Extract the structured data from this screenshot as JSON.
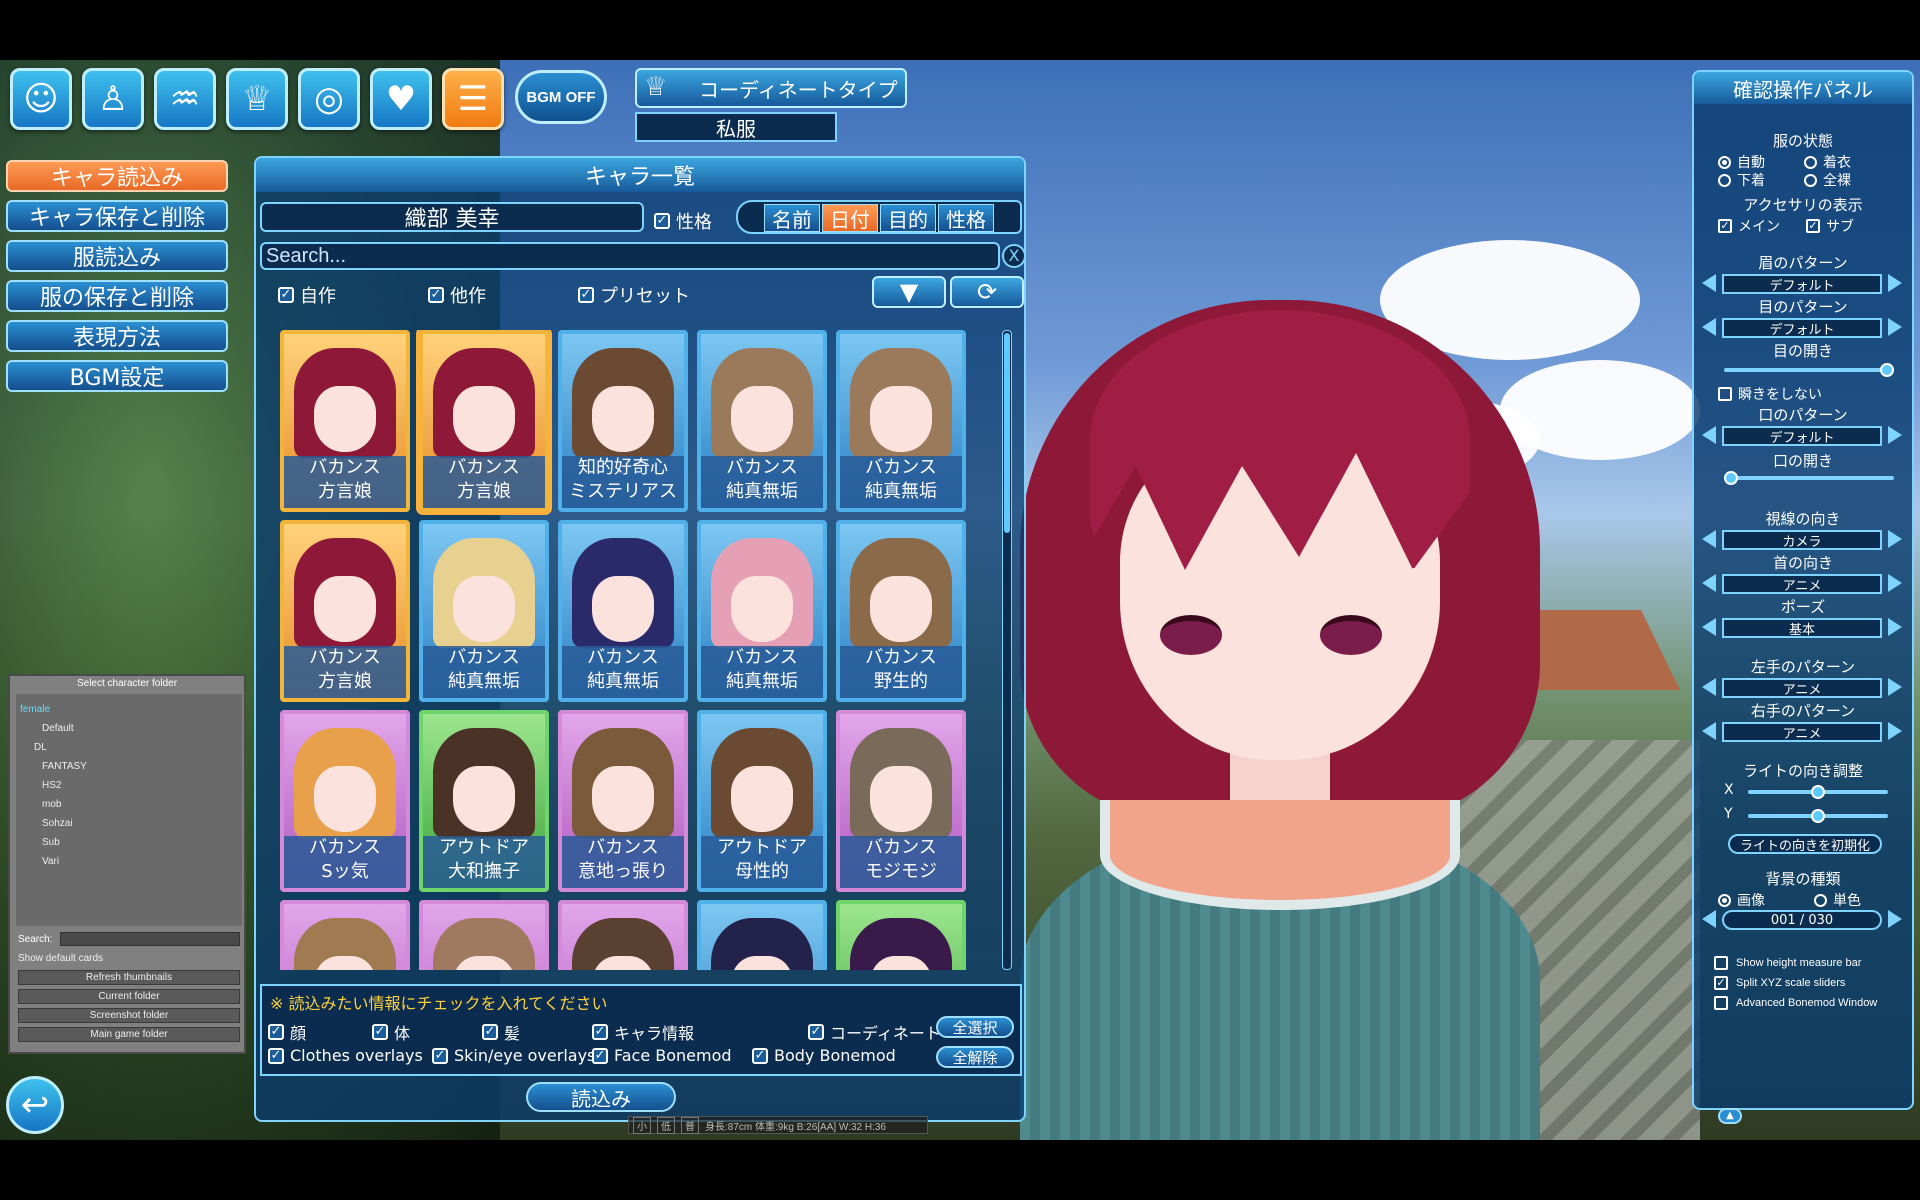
{
  "top_bar": {
    "icons": [
      {
        "name": "face-icon",
        "glyph": "☺"
      },
      {
        "name": "body-icon",
        "glyph": "♙"
      },
      {
        "name": "hair-icon",
        "glyph": "♒"
      },
      {
        "name": "clothes-icon",
        "glyph": "♕"
      },
      {
        "name": "accessory-ring-icon",
        "glyph": "◎"
      },
      {
        "name": "heart-icon",
        "glyph": "♥"
      },
      {
        "name": "menu-list-icon",
        "glyph": "☰"
      }
    ],
    "bgm_label": "BGM OFF",
    "coordinate_title": "コーディネートタイプ",
    "coordinate_value": "私服"
  },
  "left_menu": {
    "items": [
      "キャラ読込み",
      "キャラ保存と削除",
      "服読込み",
      "服の保存と削除",
      "表現方法",
      "BGM設定"
    ],
    "active_index": 0
  },
  "folder_panel": {
    "title": "Select character folder",
    "tree": [
      "female",
      "Default",
      "DL",
      "FANTASY",
      "HS2",
      "mob",
      "Sohzai",
      "Sub",
      "Vari"
    ],
    "search_label": "Search:",
    "show_default_cards": "Show default cards",
    "buttons": [
      "Refresh thumbnails",
      "Current folder",
      "Screenshot folder",
      "Main game folder"
    ]
  },
  "char_list": {
    "title": "キャラ一覧",
    "selected_name": "織部 美幸",
    "personality_toggle": "性格",
    "sort_tabs": [
      "名前",
      "日付",
      "目的",
      "性格"
    ],
    "active_sort": 1,
    "search_placeholder": "Search...",
    "clear_label": "X",
    "filters": [
      "自作",
      "他作",
      "プリセット"
    ],
    "filter_down": "▼",
    "filter_refresh": "⟳",
    "cards": [
      {
        "line1": "バカンス",
        "line2": "方言娘",
        "frame": "gold",
        "hair": "#8e1838"
      },
      {
        "line1": "バカンス",
        "line2": "方言娘",
        "frame": "gold",
        "hair": "#8e1838",
        "selected": true
      },
      {
        "line1": "知的好奇心",
        "line2": "ミステリアス",
        "frame": "blue",
        "hair": "#6a4a33"
      },
      {
        "line1": "バカンス",
        "line2": "純真無垢",
        "frame": "blue",
        "hair": "#9a7a5a"
      },
      {
        "line1": "バカンス",
        "line2": "純真無垢",
        "frame": "blue",
        "hair": "#9a7a5a"
      },
      {
        "line1": "バカンス",
        "line2": "方言娘",
        "frame": "gold",
        "hair": "#8e1838"
      },
      {
        "line1": "バカンス",
        "line2": "純真無垢",
        "frame": "blue",
        "hair": "#e8d090"
      },
      {
        "line1": "バカンス",
        "line2": "純真無垢",
        "frame": "blue",
        "hair": "#2a2a6a"
      },
      {
        "line1": "バカンス",
        "line2": "純真無垢",
        "frame": "blue",
        "hair": "#e6a0b6"
      },
      {
        "line1": "バカンス",
        "line2": "野生的",
        "frame": "blue",
        "hair": "#8a6a48"
      },
      {
        "line1": "バカンス",
        "line2": "Sッ気",
        "frame": "pink",
        "hair": "#e8a04a"
      },
      {
        "line1": "アウトドア",
        "line2": "大和撫子",
        "frame": "green",
        "hair": "#4a3326"
      },
      {
        "line1": "バカンス",
        "line2": "意地っ張り",
        "frame": "pink",
        "hair": "#7a5a3a"
      },
      {
        "line1": "アウトドア",
        "line2": "母性的",
        "frame": "blue",
        "hair": "#6a4a33"
      },
      {
        "line1": "バカンス",
        "line2": "モジモジ",
        "frame": "pink",
        "hair": "#7a6a5a"
      },
      {
        "line1": "",
        "line2": "",
        "frame": "pink",
        "hair": "#a07a50"
      },
      {
        "line1": "",
        "line2": "",
        "frame": "pink",
        "hair": "#a07a60"
      },
      {
        "line1": "",
        "line2": "",
        "frame": "pink",
        "hair": "#5a4030"
      },
      {
        "line1": "",
        "line2": "",
        "frame": "blue",
        "hair": "#22224a"
      },
      {
        "line1": "",
        "line2": "",
        "frame": "green",
        "hair": "#3a1a4a"
      }
    ],
    "load_note": "※ 読込みたい情報にチェックを入れてください",
    "load_options_row1": [
      "顔",
      "体",
      "髪",
      "キャラ情報",
      "コーディネート"
    ],
    "load_options_row2": [
      "Clothes overlays",
      "Skin/eye overlays",
      "Face Bonemod",
      "Body Bonemod"
    ],
    "select_all": "全選択",
    "deselect_all": "全解除",
    "load_button": "読込み"
  },
  "right_panel": {
    "title": "確認操作パネル",
    "clothes_state_title": "服の状態",
    "clothes_state_options": [
      "自動",
      "着衣",
      "下着",
      "全裸"
    ],
    "clothes_state_selected": 0,
    "accessory_title": "アクセサリの表示",
    "accessory_options": [
      "メイン",
      "サブ"
    ],
    "eyebrow_title": "眉のパターン",
    "eyebrow_value": "デフォルト",
    "eye_title": "目のパターン",
    "eye_value": "デフォルト",
    "eye_open_title": "目の開き",
    "eye_open_level": 1.0,
    "no_blink": "瞬きをしない",
    "mouth_title": "口のパターン",
    "mouth_value": "デフォルト",
    "mouth_open_title": "口の開き",
    "mouth_open_level": 0.0,
    "gaze_title": "視線の向き",
    "gaze_value": "カメラ",
    "neck_title": "首の向き",
    "neck_value": "アニメ",
    "pose_title": "ポーズ",
    "pose_value": "基本",
    "lhand_title": "左手のパターン",
    "lhand_value": "アニメ",
    "rhand_title": "右手のパターン",
    "rhand_value": "アニメ",
    "light_title": "ライトの向き調整",
    "light_x_label": "X",
    "light_y_label": "Y",
    "light_x_level": 0.5,
    "light_y_level": 0.5,
    "light_reset": "ライトの向きを初期化",
    "bg_title": "背景の種類",
    "bg_options": [
      "画像",
      "単色"
    ],
    "bg_value": "001 / 030",
    "extras": [
      "Show height measure bar",
      "Split XYZ scale sliders",
      "Advanced Bonemod Window"
    ],
    "extras_checked": [
      false,
      true,
      false
    ]
  },
  "status_bar": {
    "size_buttons": [
      "小",
      "低",
      "普"
    ],
    "info": "身長:87cm 体重:9kg B:26[AA] W:32 H:36"
  },
  "colors": {
    "accent_blue": "#2a8fd2",
    "accent_orange": "#f07b12",
    "hair_main": "#8e1838"
  }
}
